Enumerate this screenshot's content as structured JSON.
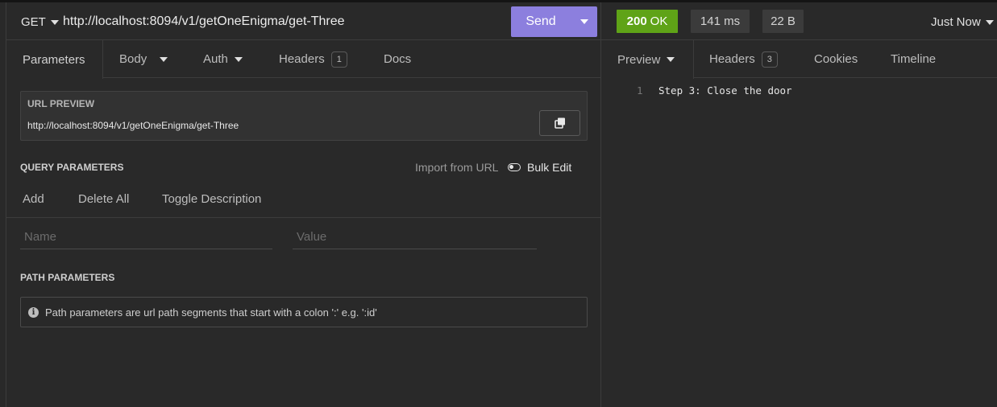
{
  "request": {
    "method": "GET",
    "url": "http://localhost:8094/v1/getOneEnigma/get-Three",
    "send_label": "Send"
  },
  "request_tabs": [
    {
      "label": "Parameters"
    },
    {
      "label": "Body"
    },
    {
      "label": "Auth"
    },
    {
      "label": "Headers",
      "count": "1"
    },
    {
      "label": "Docs"
    }
  ],
  "url_preview": {
    "title": "URL PREVIEW",
    "url": "http://localhost:8094/v1/getOneEnigma/get-Three"
  },
  "query_params": {
    "title": "QUERY PARAMETERS",
    "import_label": "Import from URL",
    "bulk_edit_label": "Bulk Edit",
    "actions": [
      "Add",
      "Delete All",
      "Toggle Description"
    ],
    "name_placeholder": "Name",
    "value_placeholder": "Value"
  },
  "path_params": {
    "title": "PATH PARAMETERS",
    "info": "Path parameters are url path segments that start with a colon ':' e.g. ':id'"
  },
  "response": {
    "status_code": "200",
    "status_text": "OK",
    "time": "141 ms",
    "size": "22 B",
    "when": "Just Now"
  },
  "response_tabs": [
    {
      "label": "Preview"
    },
    {
      "label": "Headers",
      "count": "3"
    },
    {
      "label": "Cookies"
    },
    {
      "label": "Timeline"
    }
  ],
  "response_body": {
    "line_number": "1",
    "text": "Step 3: Close the door"
  },
  "colors": {
    "send": "#8c7fde",
    "status_ok": "#5fa317",
    "background": "#292929"
  }
}
